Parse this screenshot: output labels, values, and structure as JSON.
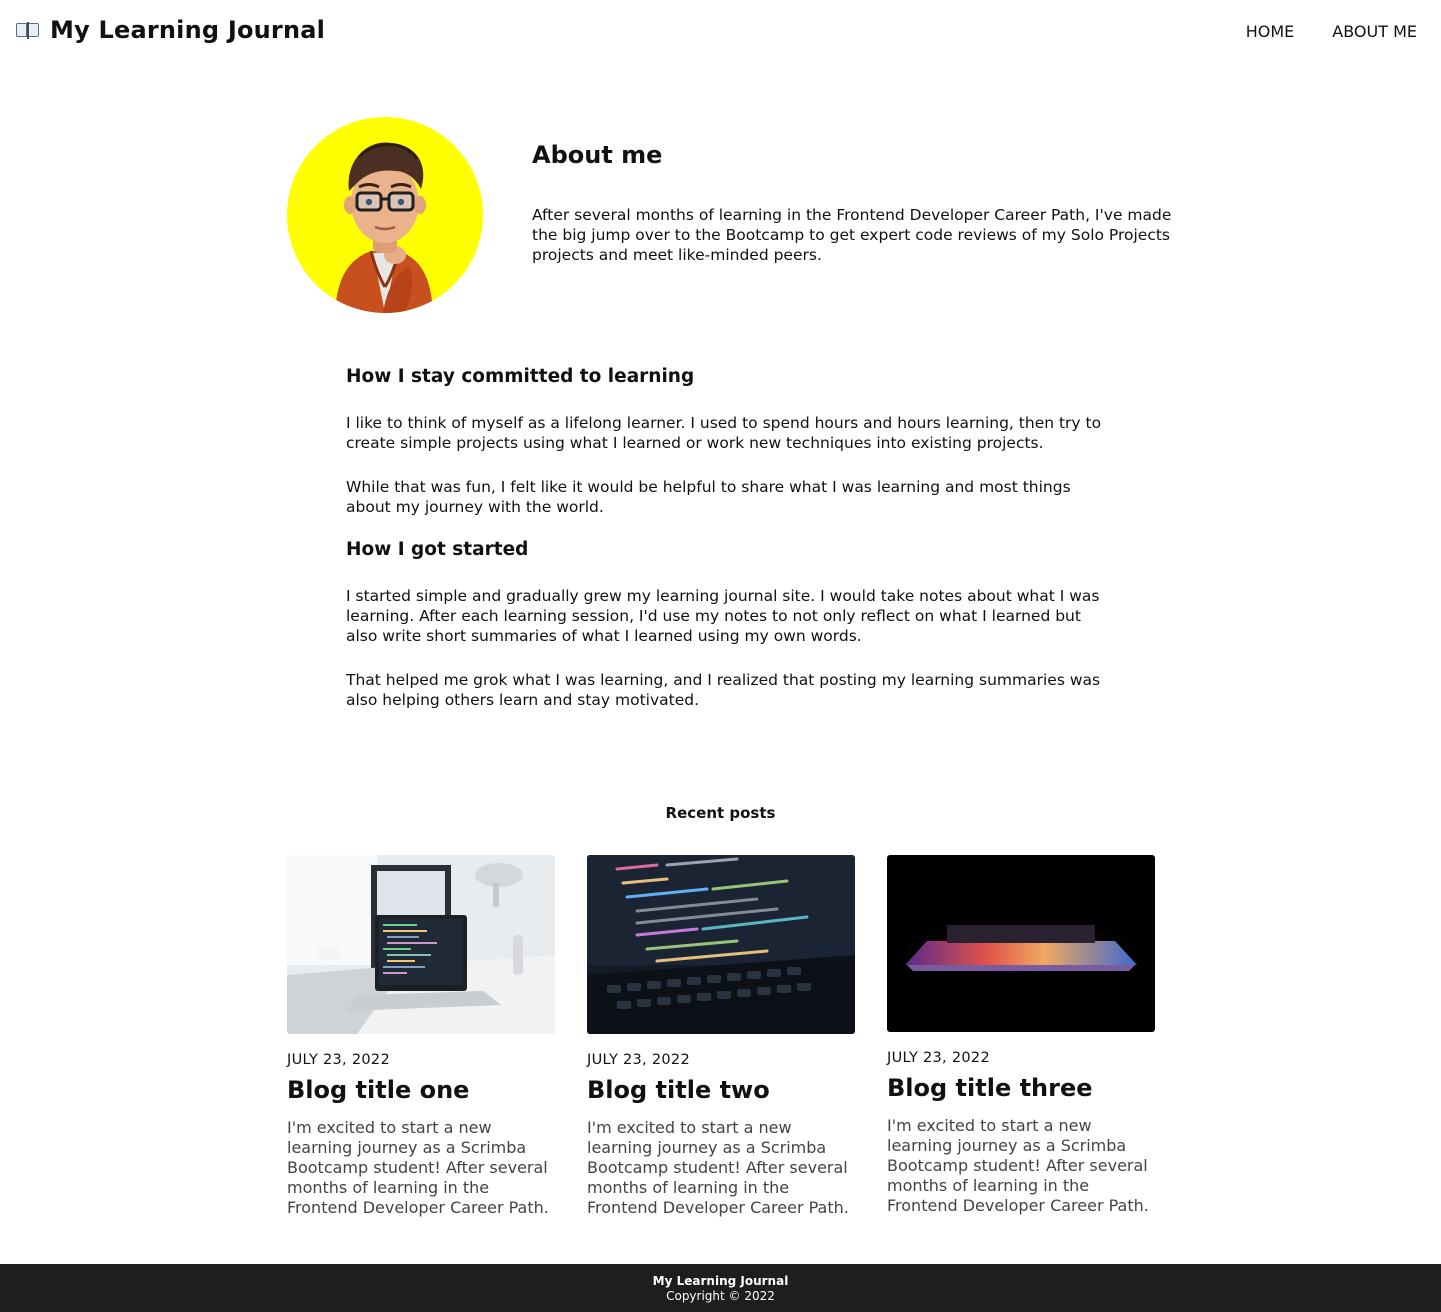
{
  "header": {
    "brand_icon": "open-book-icon",
    "title": "My Learning Journal",
    "nav": [
      {
        "label": "HOME"
      },
      {
        "label": "ABOUT ME"
      }
    ]
  },
  "about": {
    "avatar_bg": "#ffff00",
    "heading": "About me",
    "text": "After several months of learning in the Frontend Developer Career Path, I've made the big jump over to the Bootcamp to get expert code reviews of my Solo Projects projects and meet like-minded peers."
  },
  "story": {
    "heading1": "How I stay committed to learning",
    "p1": "I like to think of myself as a lifelong learner. I used to spend hours and hours learning, then try to create simple projects using what I learned or work new techniques into existing projects.",
    "p2": "While that was fun, I felt like it would be helpful to share what I was learning and most things about my journey with the world.",
    "heading2": "How I got started",
    "p3": "I started simple and gradually grew my learning journal site. I would take notes about what I was learning. After each learning session, I'd use my notes to not only reflect on what I learned but also write short summaries of what I learned using my own words.",
    "p4": "That helped me grok what I was learning, and I realized that posting my learning summaries was also helping others learn and stay motivated."
  },
  "recent": {
    "title": "Recent posts",
    "posts": [
      {
        "date": "JULY 23, 2022",
        "title": "Blog title one",
        "excerpt": "I'm excited to start a new learning journey as a Scrimba Bootcamp student! After several months of learning in the Frontend Developer Career Path."
      },
      {
        "date": "JULY 23, 2022",
        "title": "Blog title two",
        "excerpt": "I'm excited to start a new learning journey as a Scrimba Bootcamp student! After several months of learning in the Frontend Developer Career Path."
      },
      {
        "date": "JULY 23, 2022",
        "title": "Blog title three",
        "excerpt": "I'm excited to start a new learning journey as a Scrimba Bootcamp student! After several months of learning in the Frontend Developer Career Path."
      }
    ]
  },
  "footer": {
    "title": "My Learning Journal",
    "copyright": "Copyright © 2022"
  }
}
